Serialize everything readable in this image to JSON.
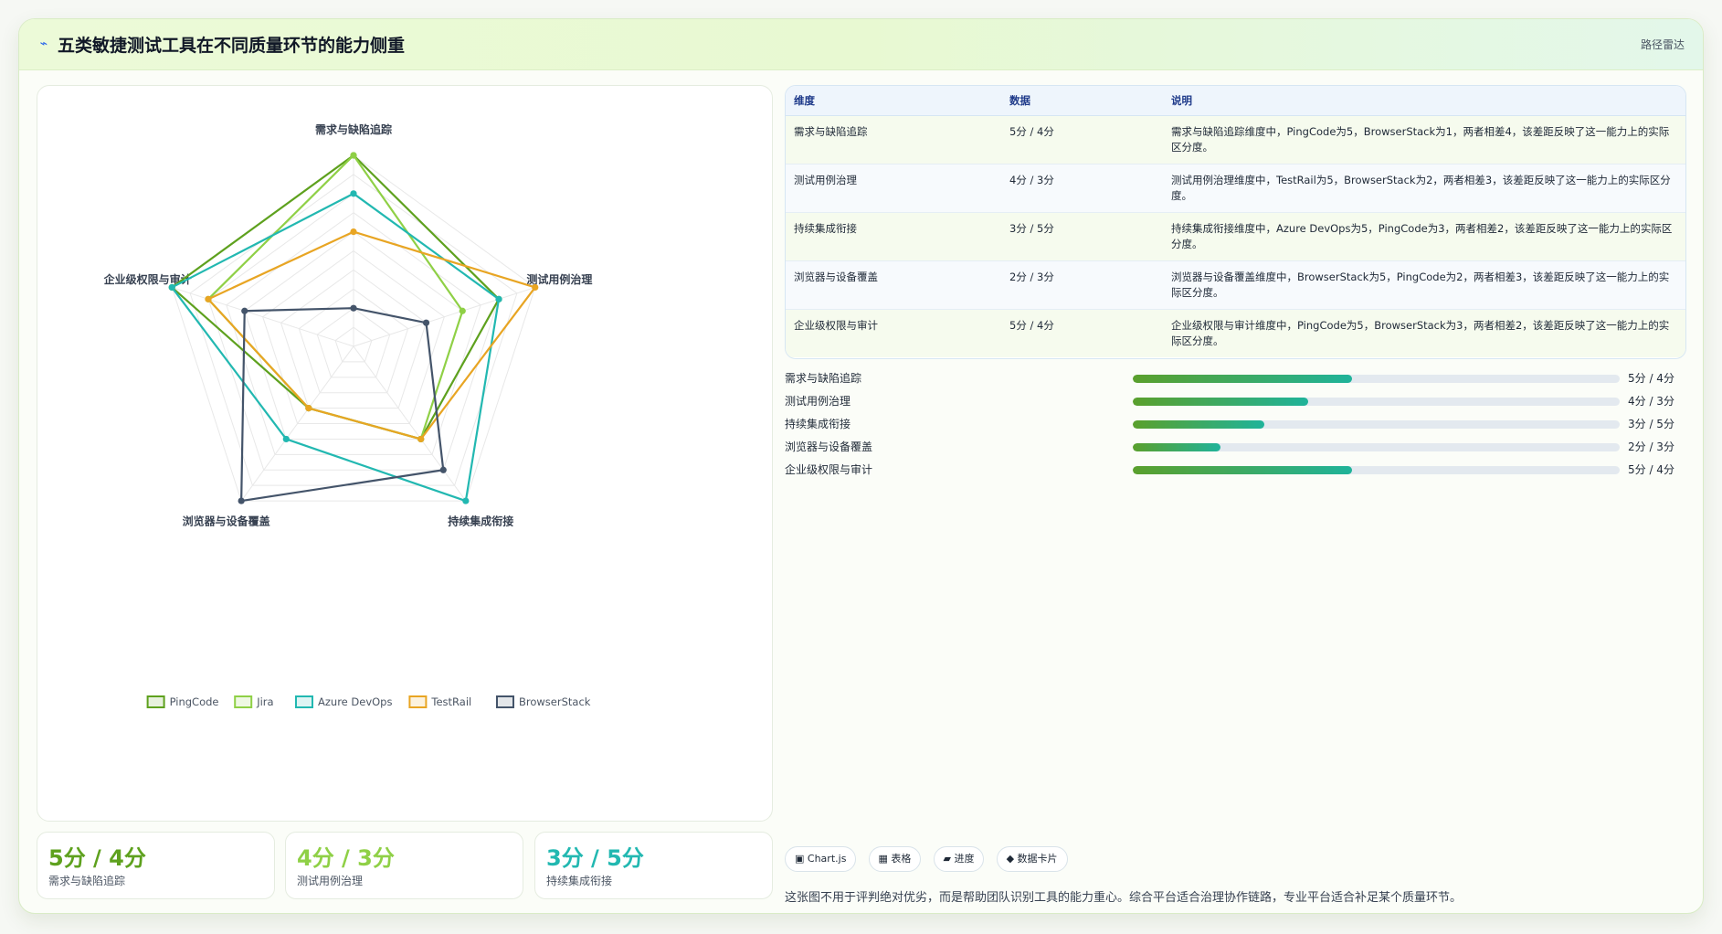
{
  "header": {
    "icon": "lightning-icon",
    "title": "五类敏捷测试工具在不同质量环节的能力侧重",
    "tag": "路径雷达"
  },
  "chart_data": {
    "type": "radar",
    "axes": [
      "需求与缺陷追踪",
      "测试用例治理",
      "持续集成衔接",
      "浏览器与设备覆盖",
      "企业级权限与审计"
    ],
    "rmax": 5,
    "series": [
      {
        "name": "PingCode",
        "values": [
          5,
          4,
          3,
          2,
          5
        ],
        "color": "#5ea11e"
      },
      {
        "name": "Jira",
        "values": [
          5,
          3,
          3,
          2,
          4
        ],
        "color": "#8fd046"
      },
      {
        "name": "Azure DevOps",
        "values": [
          4,
          4,
          5,
          3,
          5
        ],
        "color": "#22b8b1"
      },
      {
        "name": "TestRail",
        "values": [
          3,
          5,
          3,
          2,
          4
        ],
        "color": "#e8a523"
      },
      {
        "name": "BrowserStack",
        "values": [
          1,
          2,
          4,
          5,
          3
        ],
        "color": "#44546a"
      }
    ]
  },
  "stats": [
    {
      "value": "5分 / 4分",
      "label": "需求与缺陷追踪",
      "color": "#5ea11e"
    },
    {
      "value": "4分 / 3分",
      "label": "测试用例治理",
      "color": "#8fd046"
    },
    {
      "value": "3分 / 5分",
      "label": "持续集成衔接",
      "color": "#22b8b1"
    }
  ],
  "table": {
    "headers": [
      "维度",
      "数据",
      "说明"
    ],
    "rows": [
      [
        "需求与缺陷追踪",
        "5分 / 4分",
        "需求与缺陷追踪维度中，PingCode为5，BrowserStack为1，两者相差4，该差距反映了这一能力上的实际区分度。"
      ],
      [
        "测试用例治理",
        "4分 / 3分",
        "测试用例治理维度中，TestRail为5，BrowserStack为2，两者相差3，该差距反映了这一能力上的实际区分度。"
      ],
      [
        "持续集成衔接",
        "3分 / 5分",
        "持续集成衔接维度中，Azure DevOps为5，PingCode为3，两者相差2，该差距反映了这一能力上的实际区分度。"
      ],
      [
        "浏览器与设备覆盖",
        "2分 / 3分",
        "浏览器与设备覆盖维度中，BrowserStack为5，PingCode为2，两者相差3，该差距反映了这一能力上的实际区分度。"
      ],
      [
        "企业级权限与审计",
        "5分 / 4分",
        "企业级权限与审计维度中，PingCode为5，BrowserStack为3，两者相差2，该差距反映了这一能力上的实际区分度。"
      ]
    ]
  },
  "bars": [
    {
      "label": "需求与缺陷追踪",
      "value": "5分 / 4分",
      "fill": 0.45
    },
    {
      "label": "测试用例治理",
      "value": "4分 / 3分",
      "fill": 0.36
    },
    {
      "label": "持续集成衔接",
      "value": "3分 / 5分",
      "fill": 0.27
    },
    {
      "label": "浏览器与设备覆盖",
      "value": "2分 / 3分",
      "fill": 0.18
    },
    {
      "label": "企业级权限与审计",
      "value": "5分 / 4分",
      "fill": 0.45
    }
  ],
  "chips": [
    {
      "icon": "chart-icon",
      "glyph": "▣",
      "label": "Chart.js"
    },
    {
      "icon": "table-icon",
      "glyph": "▦",
      "label": "表格"
    },
    {
      "icon": "progress-icon",
      "glyph": "▰",
      "label": "进度"
    },
    {
      "icon": "card-icon",
      "glyph": "◆",
      "label": "数据卡片"
    }
  ],
  "note": "这张图不用于评判绝对优劣，而是帮助团队识别工具的能力重心。综合平台适合治理协作链路，专业平台适合补足某个质量环节。"
}
